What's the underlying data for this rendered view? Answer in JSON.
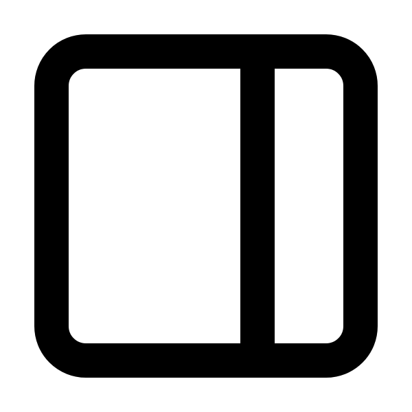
{
  "icon": {
    "name": "panel-right-sidebar-icon",
    "stroke_color": "#000000",
    "fill_color": "#FFFFFF",
    "background_color": "#FFFFFF"
  }
}
